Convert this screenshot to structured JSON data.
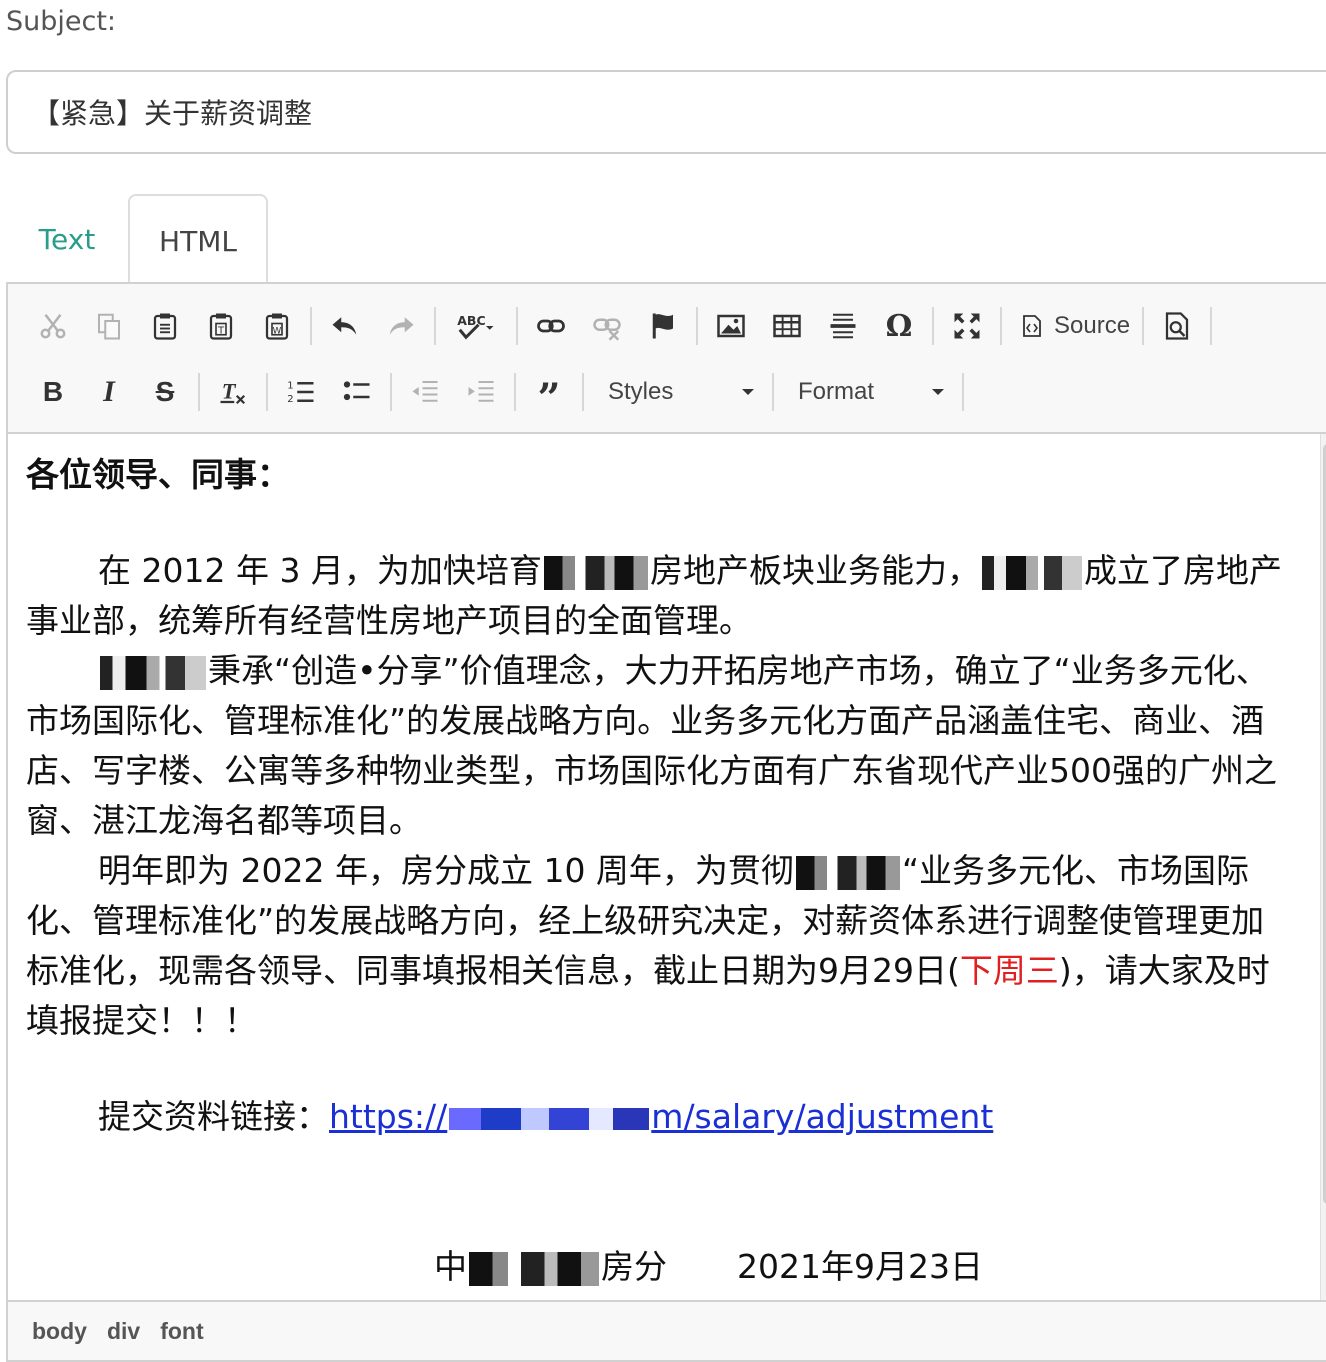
{
  "subject": {
    "label": "Subject:",
    "value": "【紧急】关于薪资调整"
  },
  "tabs": [
    {
      "label": "Text"
    },
    {
      "label": "HTML"
    }
  ],
  "toolbar": {
    "row1": [
      "cut-icon",
      "copy-icon",
      "paste-icon",
      "paste-text-icon",
      "paste-word-icon",
      "undo-icon",
      "redo-icon",
      "spellcheck-icon",
      "link-icon",
      "unlink-icon",
      "anchor-icon",
      "image-icon",
      "table-icon",
      "horizontal-rule-icon",
      "special-char-icon",
      "maximize-icon",
      "source-icon",
      "preview-icon"
    ],
    "source_label": "Source",
    "row2": [
      "bold-icon",
      "italic-icon",
      "strike-icon",
      "remove-format-icon",
      "numbered-list-icon",
      "bulleted-list-icon",
      "outdent-icon",
      "indent-icon",
      "blockquote-icon"
    ],
    "styles_label": "Styles",
    "format_label": "Format"
  },
  "body": {
    "greeting": "各位领导、同事：",
    "p1_a": "在 2012 年 3 月，为加快培育",
    "p1_b": "房地产板块业务能力，",
    "p1_c": "成立了房地产事业部，统筹所有经营性房地产项目的全面管理。",
    "p2_b": "秉承“创造•分享”价值理念，大力开拓房地产市场，确立了“业务多元化、市场国际化、管理标准化”的发展战略方向。业务多元化方面产品涵盖住宅、商业、酒店、写字楼、公寓等多种物业类型，市场国际化方面有广东省现代产业500强的广州之窗、湛江龙海名都等项目。",
    "p3_a": "明年即为 2022 年，房分成立 10 周年，为贯彻",
    "p3_b": "“业务多元化、市场国际化、管理标准化”的发展战略方向，经上级研究决定，对薪资体系进行调整使管理更加标准化，现需各领导、同事填报相关信息，截止日期为9月29日(",
    "p3_red": "下周三",
    "p3_c": ")，请大家及时填报提交！！！",
    "link_label": "提交资料链接：",
    "link_a": "https://",
    "link_b": "m/salary/adjustment",
    "sign_a": "中",
    "sign_b": "房分",
    "sign_date": "2021年9月23日"
  },
  "statusbar": [
    "body",
    "div",
    "font"
  ]
}
